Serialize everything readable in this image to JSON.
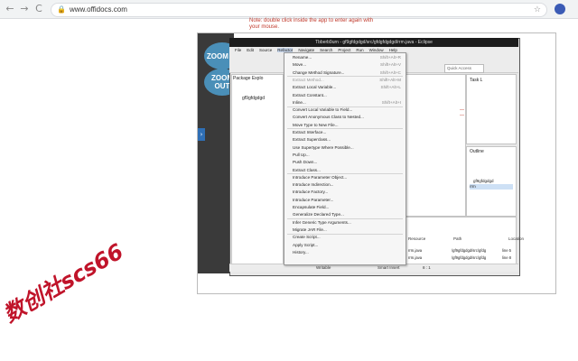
{
  "browser": {
    "back": "←",
    "forward": "→",
    "reload": "C",
    "home": "⌂",
    "url": "www.offidocs.com",
    "lock_icon": "lock-icon",
    "star_icon": "star-icon"
  },
  "hint": {
    "line1": "Note: double click inside the app to enter again with",
    "line2": "your mouse."
  },
  "viewer": {
    "zoom_in": "ZOOM IN",
    "zoom_out": "ZOOM OUT",
    "side_arrow": "›"
  },
  "eclipse": {
    "title": "Tbberb9urn - gf9gfdgdgd/src/gfdgfdgdgd/rrm.java - Eclipse",
    "menus": [
      "File",
      "Edit",
      "Source",
      "Refactor",
      "Navigate",
      "Search",
      "Project",
      "Run",
      "Window",
      "Help"
    ],
    "active_menu": "Refactor",
    "quick_access": "Quick Access",
    "package_explorer": "Package Explo",
    "project": "gf9gfdgdgd",
    "task_list": "Task L",
    "outline": "Outline",
    "outline_item1": "gf9gfdgdgd",
    "outline_item2": "rrm",
    "columns": [
      "Resource",
      "Path",
      "Location"
    ],
    "rows": [
      [
        "rrm.java",
        "/gf9gfdgdgd/src/gfdg",
        "line 5"
      ],
      [
        "rrm.java",
        "/gf9gfdgdgd/src/gfdg",
        "line 8"
      ]
    ],
    "row2_prefix": "ematic",
    "status": {
      "writable": "Writable",
      "insert": "Smart Insert",
      "pos": "8 : 1"
    }
  },
  "menu_items": [
    {
      "label": "Rename...",
      "shortcut": "Shift+Alt+R",
      "disabled": false
    },
    {
      "label": "Move...",
      "shortcut": "Shift+Alt+V",
      "disabled": false
    },
    {
      "label": "Change Method Signature...",
      "shortcut": "Shift+Alt+C",
      "disabled": false
    },
    {
      "label": "Extract Method...",
      "shortcut": "Shift+Alt+M",
      "disabled": true
    },
    {
      "label": "Extract Local Variable...",
      "shortcut": "Shift+Alt+L",
      "disabled": false
    },
    {
      "label": "Extract Constant...",
      "shortcut": "",
      "disabled": false
    },
    {
      "label": "Inline...",
      "shortcut": "Shift+Alt+I",
      "disabled": false
    },
    {
      "label": "Convert Local Variable to Field...",
      "shortcut": "",
      "disabled": false
    },
    {
      "label": "Convert Anonymous Class to Nested...",
      "shortcut": "",
      "disabled": false
    },
    {
      "label": "Move Type to New File...",
      "shortcut": "",
      "disabled": false
    },
    {
      "label": "Extract Interface...",
      "shortcut": "",
      "disabled": false
    },
    {
      "label": "Extract Superclass...",
      "shortcut": "",
      "disabled": false
    },
    {
      "label": "Use Supertype Where Possible...",
      "shortcut": "",
      "disabled": false
    },
    {
      "label": "Pull Up...",
      "shortcut": "",
      "disabled": false
    },
    {
      "label": "Push Down...",
      "shortcut": "",
      "disabled": false
    },
    {
      "label": "Extract Class...",
      "shortcut": "",
      "disabled": false
    },
    {
      "label": "Introduce Parameter Object...",
      "shortcut": "",
      "disabled": false
    },
    {
      "label": "Introduce Indirection...",
      "shortcut": "",
      "disabled": false
    },
    {
      "label": "Introduce Factory...",
      "shortcut": "",
      "disabled": false
    },
    {
      "label": "Introduce Parameter...",
      "shortcut": "",
      "disabled": false
    },
    {
      "label": "Encapsulate Field...",
      "shortcut": "",
      "disabled": false
    },
    {
      "label": "Generalize Declared Type...",
      "shortcut": "",
      "disabled": false
    },
    {
      "label": "Infer Generic Type Arguments...",
      "shortcut": "",
      "disabled": false
    },
    {
      "label": "Migrate JAR File...",
      "shortcut": "",
      "disabled": false
    },
    {
      "label": "Create Script...",
      "shortcut": "",
      "disabled": false
    },
    {
      "label": "Apply Script...",
      "shortcut": "",
      "disabled": false
    },
    {
      "label": "History...",
      "shortcut": "",
      "disabled": false
    }
  ],
  "watermark": "数创社scs66"
}
